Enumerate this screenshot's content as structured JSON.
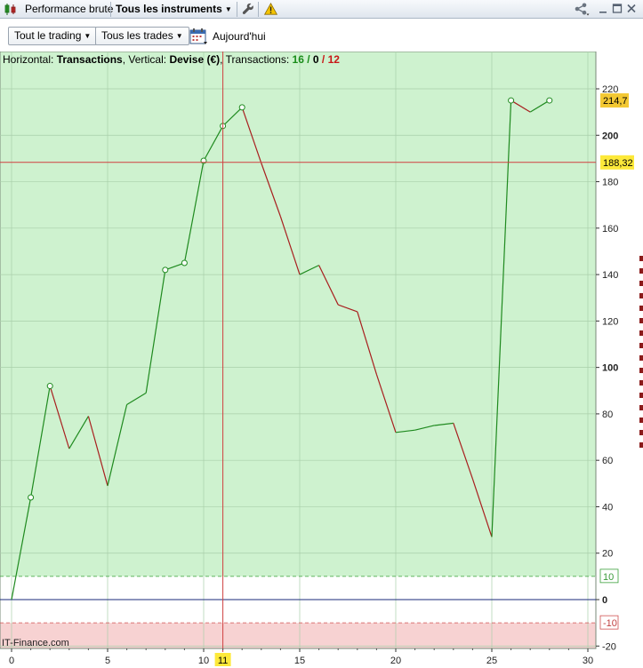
{
  "tabs": {
    "performance_label": "Performance brute",
    "instruments_label": "Tous les instruments"
  },
  "toolbar": {
    "trading_dropdown": "Tout le trading",
    "trades_dropdown": "Tous les trades",
    "date_label": "Aujourd'hui"
  },
  "info": {
    "horizontal_label": "Horizontal:",
    "horizontal_value": "Transactions",
    "vertical_label": "Vertical:",
    "vertical_value": "Devise (€)",
    "transactions_label": "Transactions:",
    "win_count": "16",
    "neutral_count": "0",
    "loss_count": "12"
  },
  "watermark": "IT-Finance.com",
  "colors": {
    "profit_zone": "#cef2cf",
    "loss_zone": "#f7d2d2",
    "up_line": "#1f8a1f",
    "down_line": "#a81f1f",
    "cursor_line": "#d04040",
    "zero_line": "#1a2a7a",
    "highlight_label": "#fde93a"
  },
  "chart_data": {
    "type": "line",
    "x_axis": {
      "range": [
        0,
        30
      ],
      "ticks": [
        0,
        5,
        10,
        15,
        20,
        25,
        30
      ]
    },
    "y_axis": {
      "range": [
        -20,
        232
      ],
      "ticks": [
        -20,
        0,
        20,
        40,
        60,
        80,
        100,
        120,
        140,
        160,
        180,
        200,
        220
      ],
      "bold_ticks": [
        0,
        100,
        200
      ]
    },
    "guide_lines": [
      10,
      -10
    ],
    "guide_labels": [
      "10",
      "-10"
    ],
    "cursor": {
      "x": 11,
      "x_label": "11",
      "y": 188.32,
      "y_label": "188,32"
    },
    "last_value_label": "214,7",
    "grid": true,
    "series": [
      {
        "points": [
          [
            0,
            0
          ],
          [
            1,
            44
          ],
          [
            2,
            92
          ],
          [
            3,
            65
          ],
          [
            4,
            79
          ],
          [
            5,
            49
          ],
          [
            6,
            84
          ],
          [
            7,
            89
          ],
          [
            8,
            142
          ],
          [
            9,
            145
          ],
          [
            10,
            189
          ],
          [
            11,
            204
          ],
          [
            12,
            212
          ],
          [
            13,
            188
          ],
          [
            14,
            165
          ],
          [
            15,
            140
          ],
          [
            16,
            144
          ],
          [
            17,
            127
          ],
          [
            18,
            124
          ],
          [
            19,
            97
          ],
          [
            20,
            72
          ],
          [
            21,
            73
          ],
          [
            22,
            75
          ],
          [
            23,
            76
          ],
          [
            24,
            52
          ],
          [
            25,
            27
          ],
          [
            26,
            215
          ],
          [
            27,
            210
          ],
          [
            28,
            215
          ]
        ],
        "markers": [
          1,
          2,
          8,
          9,
          10,
          11,
          12,
          26,
          28
        ]
      }
    ]
  }
}
